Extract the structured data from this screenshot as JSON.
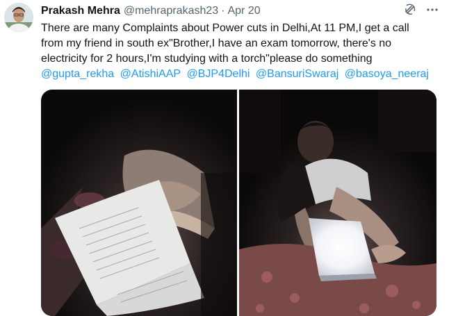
{
  "tweet": {
    "author_name": "Prakash Mehra",
    "author_handle": "@mehraprakash23",
    "separator": "·",
    "date": "Apr 20",
    "text_lines": [
      "There are many Complaints about Power cuts in Delhi,At 11 PM,I get a call",
      "from my friend in south ex\"Brother,I have an exam tomorrow, there's no",
      "electricity for 2 hours,I'm studying with a torch\"please do something"
    ],
    "mentions": [
      "@gupta_rekha",
      "@AtishiAAP",
      "@BJP4Delhi",
      "@BansuriSwaraj",
      "@basoya_neeraj"
    ]
  },
  "icons": {
    "grok": "grok-icon",
    "more": "more-options-icon"
  },
  "colors": {
    "link": "#1d9bf0",
    "secondary_text": "#536471",
    "primary_text": "#0f1419"
  }
}
